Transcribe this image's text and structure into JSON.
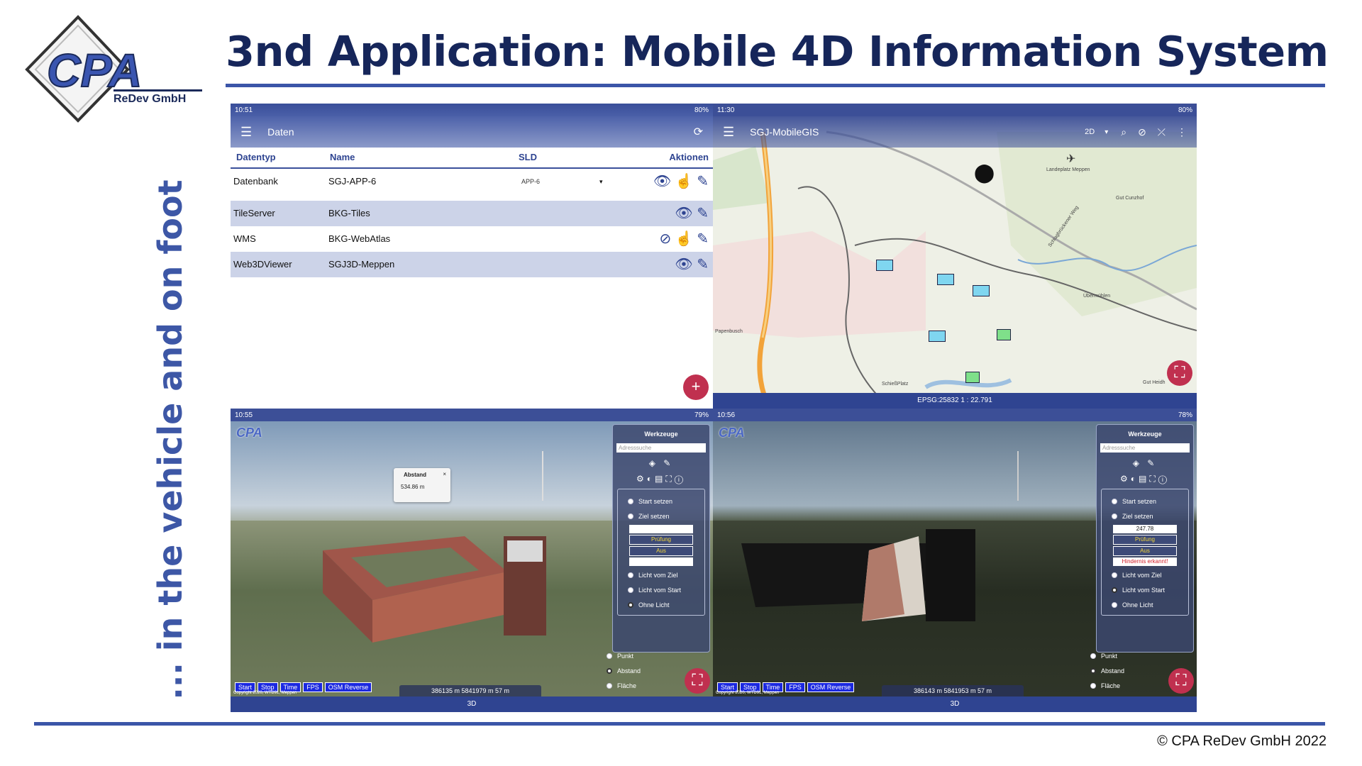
{
  "logo": {
    "text": "CPA",
    "subtext": "ReDev GmbH"
  },
  "title": "3nd Application: Mobile 4D Information System",
  "side_text": "... in the vehicle and on foot",
  "copyright": "© CPA ReDev GmbH 2022",
  "colors": {
    "brand_blue": "#3b55a8",
    "title_navy": "#16265a",
    "fab_red": "#c0304f"
  },
  "panel_data": {
    "status_time": "10:51",
    "status_battery": "80%",
    "app_title": "Daten",
    "columns": [
      "Datentyp",
      "Name",
      "SLD",
      "Aktionen"
    ],
    "rows": [
      {
        "type": "Datenbank",
        "name": "SGJ-APP-6",
        "sld": "APP-6"
      },
      {
        "type": "TileServer",
        "name": "BKG-Tiles",
        "sld": ""
      },
      {
        "type": "WMS",
        "name": "BKG-WebAtlas",
        "sld": ""
      },
      {
        "type": "Web3DViewer",
        "name": "SGJ3D-Meppen",
        "sld": ""
      }
    ],
    "fab": "+"
  },
  "panel_map": {
    "status_time": "11:30",
    "status_battery": "80%",
    "app_title": "SGJ-MobileGIS",
    "mode": "2D",
    "labels": [
      "Landeplatz Meppen",
      "Schlagbrückener Weg",
      "Gut Cunzhof",
      "Übermühlen",
      "Papenbusch",
      "SchießPlatz",
      "Gut Heidh"
    ],
    "footer": "EPSG:25832    1 : 22.791"
  },
  "panel_3d_left": {
    "status_time": "10:55",
    "status_battery": "79%",
    "tools_title": "Werkzeuge",
    "search_placeholder": "Adresssuche",
    "start": "Start setzen",
    "goal": "Ziel setzen",
    "field1": "",
    "pruefung": "Prüfung",
    "aus": "Aus",
    "field2": "",
    "licht_ziel": "Licht vom Ziel",
    "licht_start": "Licht vom Start",
    "ohne_licht": "Ohne Licht",
    "punkt": "Punkt",
    "abstand": "Abstand",
    "flaeche": "Fläche",
    "popup_title": "Abstand",
    "popup_value": "534.86 m",
    "buttons": [
      "Start",
      "Stop",
      "Time",
      "FPS",
      "OSM Reverse"
    ],
    "coords": "386135 m   5841979 m   57 m",
    "copyright": "Copyright 2020, WTD91, Meppen",
    "footer": "3D"
  },
  "panel_3d_right": {
    "status_time": "10:56",
    "status_battery": "78%",
    "tools_title": "Werkzeuge",
    "search_placeholder": "Adresssuche",
    "start": "Start setzen",
    "goal": "Ziel setzen",
    "field1": "247.78",
    "pruefung": "Prüfung",
    "aus": "Aus",
    "hindernis": "Hindernis erkannt!",
    "licht_ziel": "Licht vom Ziel",
    "licht_start": "Licht vom Start",
    "ohne_licht": "Ohne Licht",
    "punkt": "Punkt",
    "abstand": "Abstand",
    "flaeche": "Fläche",
    "buttons": [
      "Start",
      "Stop",
      "Time",
      "FPS",
      "OSM Reverse"
    ],
    "coords": "386143 m   5841953 m   57 m",
    "copyright": "Copyright 2020, WTD91, Meppen",
    "footer": "3D"
  }
}
